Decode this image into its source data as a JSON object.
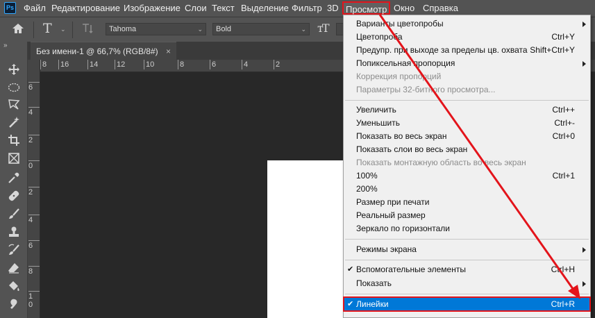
{
  "app": {
    "logo": "Ps"
  },
  "menubar": {
    "items": [
      "Файл",
      "Редактирование",
      "Изображение",
      "Слои",
      "Текст",
      "Выделение",
      "Фильтр",
      "3D",
      "Просмотр",
      "Окно",
      "Справка"
    ],
    "active": "Просмотр"
  },
  "options": {
    "font_family": "Tahoma",
    "font_style": "Bold",
    "font_size_partial": "T"
  },
  "document": {
    "tab_title": "Без имени-1 @ 66,7% (RGB/8#)",
    "close": "×"
  },
  "rulers": {
    "horizontal": [
      "8",
      "16",
      "14",
      "12",
      "10",
      "8",
      "6",
      "4",
      "2"
    ],
    "vertical": [
      "6",
      "4",
      "2",
      "0",
      "2",
      "4",
      "6",
      "8",
      "1\n0",
      "1\n2",
      "1\n4"
    ]
  },
  "tool_icons": [
    "move-icon",
    "marquee-icon",
    "lasso-icon",
    "magic-wand-icon",
    "crop-icon",
    "frame-icon",
    "eyedropper-icon",
    "healing-icon",
    "brush-icon",
    "stamp-icon",
    "history-brush-icon",
    "eraser-icon",
    "paint-bucket-icon",
    "smudge-icon"
  ],
  "view_menu": {
    "items": [
      {
        "label": "Варианты цветопробы",
        "shortcut": "",
        "submenu": true,
        "disabled": false,
        "checked": false
      },
      {
        "label": "Цветопроба",
        "shortcut": "Ctrl+Y",
        "submenu": false,
        "disabled": false,
        "checked": false
      },
      {
        "label": "Предупр. при выходе за пределы цв. охвата",
        "shortcut": "Shift+Ctrl+Y",
        "submenu": false,
        "disabled": false,
        "checked": false
      },
      {
        "label": "Попиксельная пропорция",
        "shortcut": "",
        "submenu": true,
        "disabled": false,
        "checked": false
      },
      {
        "label": "Коррекция пропорций",
        "shortcut": "",
        "submenu": false,
        "disabled": true,
        "checked": false
      },
      {
        "label": "Параметры 32-битного просмотра...",
        "shortcut": "",
        "submenu": false,
        "disabled": true,
        "checked": false
      },
      {
        "label": "Увеличить",
        "shortcut": "Ctrl++",
        "submenu": false,
        "disabled": false,
        "checked": false
      },
      {
        "label": "Уменьшить",
        "shortcut": "Ctrl+-",
        "submenu": false,
        "disabled": false,
        "checked": false
      },
      {
        "label": "Показать во весь экран",
        "shortcut": "Ctrl+0",
        "submenu": false,
        "disabled": false,
        "checked": false
      },
      {
        "label": "Показать слои во весь экран",
        "shortcut": "",
        "submenu": false,
        "disabled": false,
        "checked": false
      },
      {
        "label": "Показать монтажную область во весь экран",
        "shortcut": "",
        "submenu": false,
        "disabled": true,
        "checked": false
      },
      {
        "label": "100%",
        "shortcut": "Ctrl+1",
        "submenu": false,
        "disabled": false,
        "checked": false
      },
      {
        "label": "200%",
        "shortcut": "",
        "submenu": false,
        "disabled": false,
        "checked": false
      },
      {
        "label": "Размер при печати",
        "shortcut": "",
        "submenu": false,
        "disabled": false,
        "checked": false
      },
      {
        "label": "Реальный размер",
        "shortcut": "",
        "submenu": false,
        "disabled": false,
        "checked": false
      },
      {
        "label": "Зеркало по горизонтали",
        "shortcut": "",
        "submenu": false,
        "disabled": false,
        "checked": false
      },
      {
        "label": "Режимы экрана",
        "shortcut": "",
        "submenu": true,
        "disabled": false,
        "checked": false
      },
      {
        "label": "Вспомогательные элементы",
        "shortcut": "Ctrl+H",
        "submenu": false,
        "disabled": false,
        "checked": true
      },
      {
        "label": "Показать",
        "shortcut": "",
        "submenu": true,
        "disabled": false,
        "checked": false
      },
      {
        "label": "Линейки",
        "shortcut": "Ctrl+R",
        "submenu": false,
        "disabled": false,
        "checked": true,
        "highlighted": true
      }
    ]
  },
  "colors": {
    "highlight": "#0078d7",
    "annotation": "#e3141b",
    "menubar": "#535353"
  }
}
